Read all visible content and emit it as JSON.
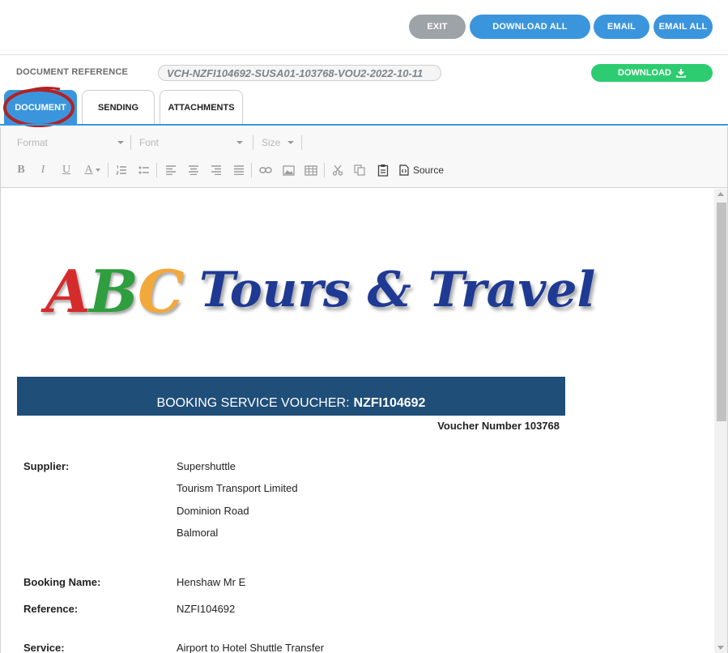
{
  "top_actions": {
    "exit": "EXIT",
    "download_all": "DOWNLOAD ALL",
    "email": "EMAIL",
    "email_all": "EMAIL ALL"
  },
  "document_reference": {
    "label": "DOCUMENT REFERENCE",
    "value": "VCH-NZFI104692-SUSA01-103768-VOU2-2022-10-11",
    "download_label": "DOWNLOAD"
  },
  "tabs": [
    {
      "label": "DOCUMENT",
      "active": true
    },
    {
      "label": "SENDING",
      "active": false
    },
    {
      "label": "ATTACHMENTS",
      "active": false
    }
  ],
  "editor_toolbar": {
    "format": "Format",
    "font": "Font",
    "size": "Size",
    "bold": "B",
    "italic": "I",
    "underline": "U",
    "text_color": "A",
    "source": "Source"
  },
  "document": {
    "logo_text_1": "ABC",
    "logo_text_2": "Tours & Travel",
    "banner_prefix": "BOOKING SERVICE VOUCHER:",
    "banner_code": "NZFI104692",
    "voucher_number": "Voucher Number 103768",
    "supplier_label": "Supplier:",
    "supplier_lines": [
      "Supershuttle",
      "Tourism Transport Limited",
      "Dominion Road",
      "Balmoral"
    ],
    "booking_name_label": "Booking Name:",
    "booking_name": "Henshaw Mr E",
    "reference_label": "Reference:",
    "reference": "NZFI104692",
    "service_label": "Service:",
    "service": "Airport to Hotel Shuttle Transfer"
  },
  "colors": {
    "primary": "#3b95dd",
    "exit": "#9ea3a8",
    "download": "#2ecc71",
    "banner": "#1f4e79",
    "logo_a": "#d62b2b",
    "logo_b": "#2e9e3f",
    "logo_c": "#f2a93b",
    "logo_text": "#1f3a93",
    "highlight_circle": "#b22222"
  }
}
